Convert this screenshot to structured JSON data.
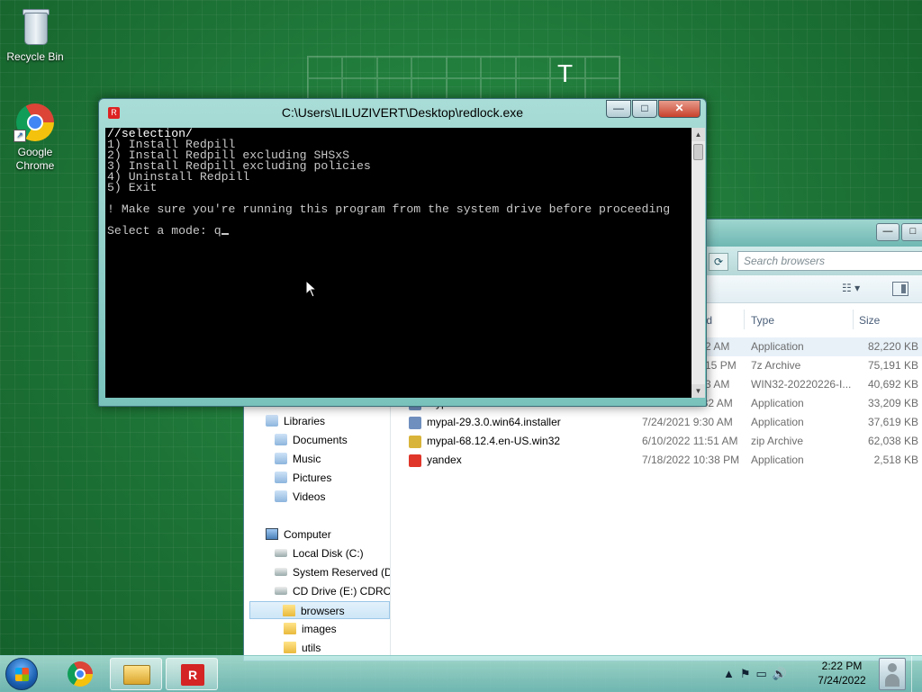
{
  "desktop": {
    "icons": [
      {
        "label": "Recycle Bin"
      },
      {
        "label": "Google Chrome"
      }
    ],
    "grid_letter": "T"
  },
  "console": {
    "title": "C:\\Users\\LILUZIVERT\\Desktop\\redlock.exe",
    "app_icon": "R",
    "lines": [
      "//selection/",
      "1) Install Redpill",
      "2) Install Redpill excluding SHSxS",
      "3) Install Redpill excluding policies",
      "4) Uninstall Redpill",
      "5) Exit",
      "",
      "! Make sure you're running this program from the system drive before proceeding",
      "",
      "Select a mode: q"
    ],
    "buttons": {
      "minimize": "—",
      "maximize": "□",
      "close": "✕"
    }
  },
  "explorer": {
    "search_placeholder": "Search browsers",
    "columns": {
      "date": "ied",
      "type": "Type",
      "size": "Size"
    },
    "nav": [
      {
        "label": "Libraries",
        "kind": "lib"
      },
      {
        "label": "Documents",
        "kind": "lib"
      },
      {
        "label": "Music",
        "kind": "lib"
      },
      {
        "label": "Pictures",
        "kind": "lib"
      },
      {
        "label": "Videos",
        "kind": "lib"
      },
      {
        "label": "Computer",
        "kind": "comp"
      },
      {
        "label": "Local Disk (C:)",
        "kind": "drive"
      },
      {
        "label": "System Reserved (D:",
        "kind": "drive"
      },
      {
        "label": "CD Drive (E:) CDROM",
        "kind": "drive"
      },
      {
        "label": "browsers",
        "kind": "folder",
        "selected": true
      },
      {
        "label": "images",
        "kind": "folder"
      },
      {
        "label": "utils",
        "kind": "folder"
      }
    ],
    "files": [
      {
        "name": "",
        "date": ":52 AM",
        "type": "Application",
        "size": "82,220 KB",
        "icon_color": "#5a7fb5",
        "selected": true
      },
      {
        "name": "",
        "date": "0:15 PM",
        "type": "7z Archive",
        "size": "75,191 KB",
        "icon_color": "#7a7a7a"
      },
      {
        "name": "",
        "date": ":03 AM",
        "type": "WIN32-20220226-I...",
        "size": "40,692 KB",
        "icon_color": "#7a7a7a"
      },
      {
        "name": "mypal-29.3.0.win32.installer",
        "date": "7/24/2021 9:32 AM",
        "type": "Application",
        "size": "33,209 KB",
        "icon_color": "#6f8fbf"
      },
      {
        "name": "mypal-29.3.0.win64.installer",
        "date": "7/24/2021 9:30 AM",
        "type": "Application",
        "size": "37,619 KB",
        "icon_color": "#6f8fbf"
      },
      {
        "name": "mypal-68.12.4.en-US.win32",
        "date": "6/10/2022 11:51 AM",
        "type": "zip Archive",
        "size": "62,038 KB",
        "icon_color": "#d9b43a"
      },
      {
        "name": "yandex",
        "date": "7/18/2022 10:38 PM",
        "type": "Application",
        "size": "2,518 KB",
        "icon_color": "#e0362a"
      }
    ]
  },
  "taskbar": {
    "apps": [
      {
        "name": "chrome"
      },
      {
        "name": "explorer"
      },
      {
        "name": "redlock",
        "label": "R"
      }
    ],
    "tray_icons": [
      "▲",
      "⚑",
      "▭",
      "🔊"
    ],
    "time": "2:22 PM",
    "date": "7/24/2022"
  }
}
